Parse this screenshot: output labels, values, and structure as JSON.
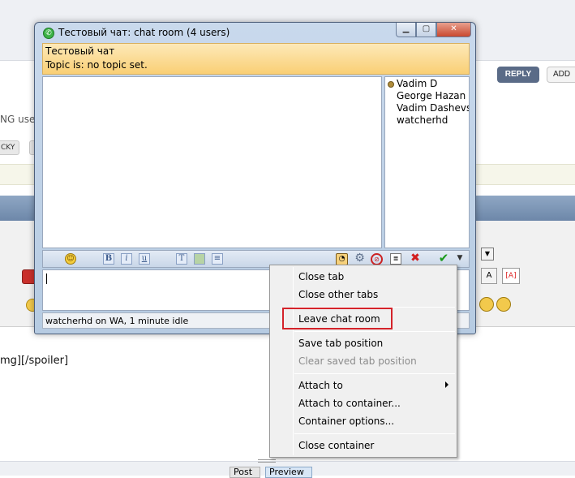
{
  "background": {
    "reply_label": "REPLY",
    "add_label": "ADD",
    "users_text": "NG user",
    "sticky_label": "CKY",
    "spoiler_text": "mg][/spoiler]",
    "post_label": "Post",
    "preview_label": "Preview"
  },
  "window": {
    "title": "Тестовый чат: chat room (4 users)",
    "min_icon": "minimize-icon",
    "max_icon": "maximize-icon",
    "close_icon": "close-icon"
  },
  "topic": {
    "room_name": "Тестовый чат",
    "topic_line": "Topic is:  no topic set."
  },
  "users": [
    "Vadim D",
    "George Hazan",
    "Vadim Dashevskiy",
    "watcherhd"
  ],
  "toolbar": {
    "icons": [
      "smiley-icon",
      "bold-icon",
      "italic-icon",
      "underline-icon",
      "text-color-icon",
      "background-color-icon",
      "list-icon",
      "history-icon",
      "settings-icon",
      "ignore-icon",
      "log-icon",
      "close-icon",
      "send-icon",
      "dropdown-arrow-icon"
    ]
  },
  "status": {
    "text": "watcherhd on WA, 1 minute idle"
  },
  "context_menu": {
    "items": [
      {
        "label": "Close tab",
        "enabled": true
      },
      {
        "label": "Close other tabs",
        "enabled": true
      },
      {
        "label": "Leave chat room",
        "enabled": true
      },
      {
        "label": "Save tab position",
        "enabled": true
      },
      {
        "label": "Clear saved tab position",
        "enabled": false
      },
      {
        "label": "Attach to",
        "enabled": true,
        "submenu": true
      },
      {
        "label": "Attach to container...",
        "enabled": true
      },
      {
        "label": "Container options...",
        "enabled": true
      },
      {
        "label": "Close container",
        "enabled": true
      }
    ],
    "highlight_color": "#d4232a"
  }
}
